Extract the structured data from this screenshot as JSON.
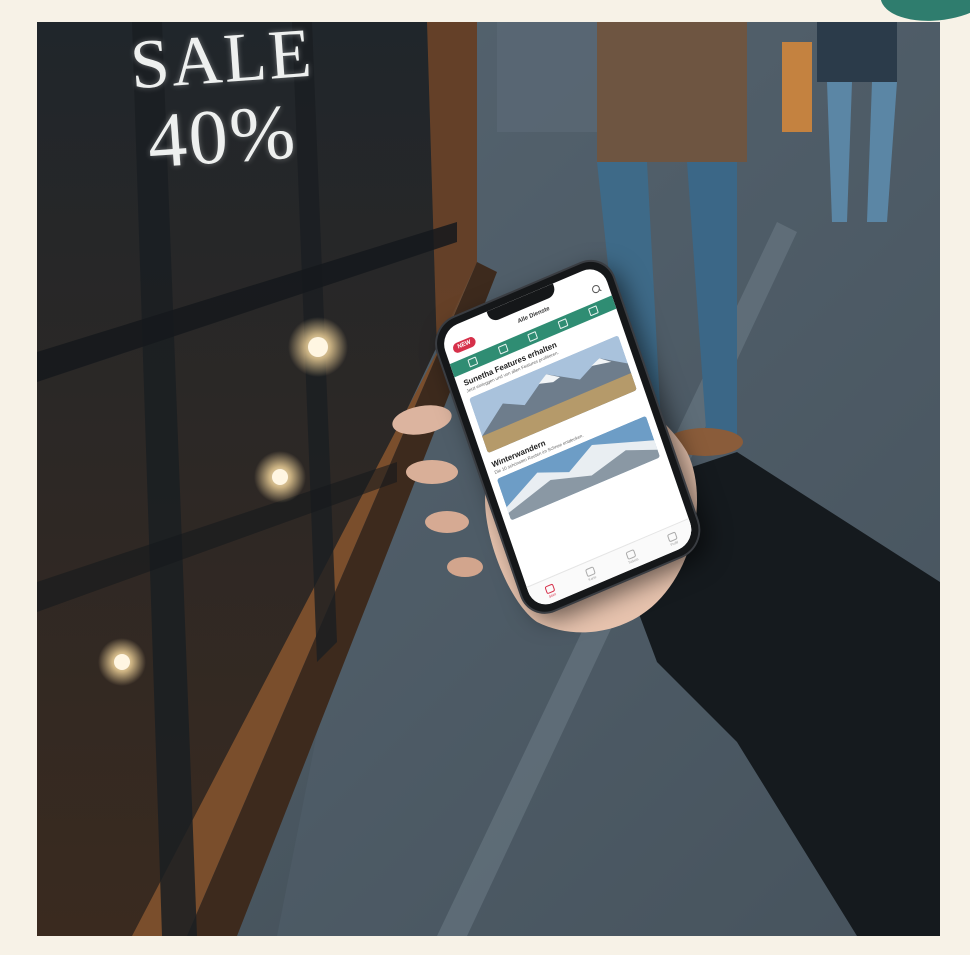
{
  "colors": {
    "frame": "#f7f2e7",
    "accent": "#d6304a",
    "teal": "#2f8d73"
  },
  "window_sign": {
    "line1": "SALE",
    "line2": "40%"
  },
  "phone_app": {
    "badge": "NEW",
    "app_title": "Alle Dienste",
    "header_icons": [
      "search-icon"
    ],
    "category_icons": [
      "category-icon",
      "calendar-icon",
      "briefcase-icon",
      "chat-icon",
      "bell-icon"
    ],
    "cards": [
      {
        "title": "Sunetha Features erhalten",
        "text": "Jetzt einloggen und von allen Features profitieren.",
        "image": "mountain-landscape"
      },
      {
        "title": "Winterwandern",
        "text": "Die 10 schönsten Routen im Schnee entdecken.",
        "image": "snowy-mountain"
      }
    ],
    "tabs": [
      {
        "label": "Start",
        "icon": "home-icon",
        "active": true
      },
      {
        "label": "Karte",
        "icon": "map-icon",
        "active": false
      },
      {
        "label": "Tickets",
        "icon": "ticket-icon",
        "active": false
      },
      {
        "label": "Profil",
        "icon": "user-icon",
        "active": false
      }
    ]
  }
}
